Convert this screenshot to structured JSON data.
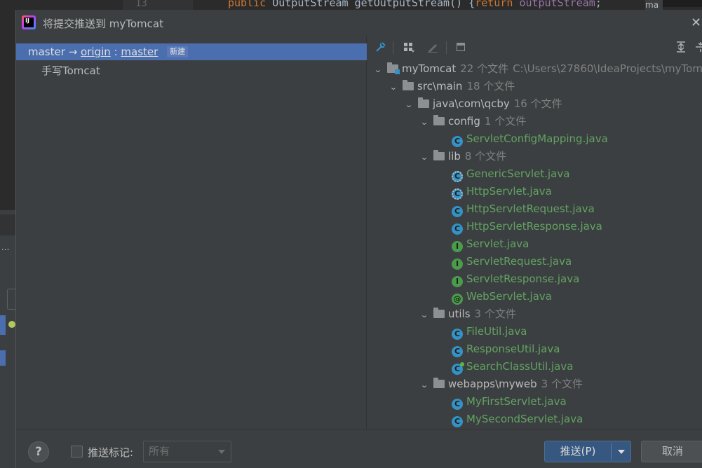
{
  "background": {
    "line_number": "13",
    "code_keyword": "public",
    "code_type": "OutputStream",
    "code_method": "getOutputStream() {",
    "code_return": "return",
    "code_field": "outputStream",
    "code_end": ";",
    "right_tab": "ma",
    "left_label": "..."
  },
  "dialog": {
    "title": "将提交推送到 myTomcat",
    "close_glyph": "✕"
  },
  "commits": {
    "local_branch": "master",
    "arrow": "→",
    "remote": "origin",
    "colon": ":",
    "remote_branch": "master",
    "badge": "新建",
    "commit_message": "手写Tomcat"
  },
  "toolbar": {
    "icons": [
      "expand-pin-icon",
      "group-by-icon",
      "edit-icon",
      "diff-icon",
      "expand-all-icon",
      "collapse-all-icon"
    ]
  },
  "tree": {
    "root": {
      "name": "myTomcat",
      "count": "22 个文件",
      "path": "C:\\Users\\27860\\IdeaProjects\\myTom"
    },
    "src": {
      "name": "src\\main",
      "count": "18 个文件"
    },
    "pkg": {
      "name": "java\\com\\qcby",
      "count": "16 个文件"
    },
    "config": {
      "name": "config",
      "count": "1 个文件"
    },
    "config_files": [
      {
        "name": "ServletConfigMapping.java",
        "icon": "class"
      }
    ],
    "lib": {
      "name": "lib",
      "count": "8 个文件"
    },
    "lib_files": [
      {
        "name": "GenericServlet.java",
        "icon": "abstract"
      },
      {
        "name": "HttpServlet.java",
        "icon": "abstract"
      },
      {
        "name": "HttpServletRequest.java",
        "icon": "class"
      },
      {
        "name": "HttpServletResponse.java",
        "icon": "class"
      },
      {
        "name": "Servlet.java",
        "icon": "interface"
      },
      {
        "name": "ServletRequest.java",
        "icon": "interface"
      },
      {
        "name": "ServletResponse.java",
        "icon": "interface"
      },
      {
        "name": "WebServlet.java",
        "icon": "annotation"
      }
    ],
    "utils": {
      "name": "utils",
      "count": "3 个文件"
    },
    "utils_files": [
      {
        "name": "FileUtil.java",
        "icon": "class"
      },
      {
        "name": "ResponseUtil.java",
        "icon": "class"
      },
      {
        "name": "SearchClassUtil.java",
        "icon": "main"
      }
    ],
    "webapps": {
      "name": "webapps\\myweb",
      "count": "3 个文件"
    },
    "webapps_files": [
      {
        "name": "MyFirstServlet.java",
        "icon": "class"
      },
      {
        "name": "MySecondServlet.java",
        "icon": "class"
      }
    ]
  },
  "bottom": {
    "help": "?",
    "push_tags_label": "推送标记:",
    "tags_select_value": "所有",
    "push_button": "推送(P)",
    "cancel_button": "取消"
  },
  "colors": {
    "selection": "#4b6eaf",
    "push_button": "#365880",
    "new_file_green": "#62a362",
    "class_icon": "#3592c4",
    "interface_icon": "#4a9b4a"
  }
}
